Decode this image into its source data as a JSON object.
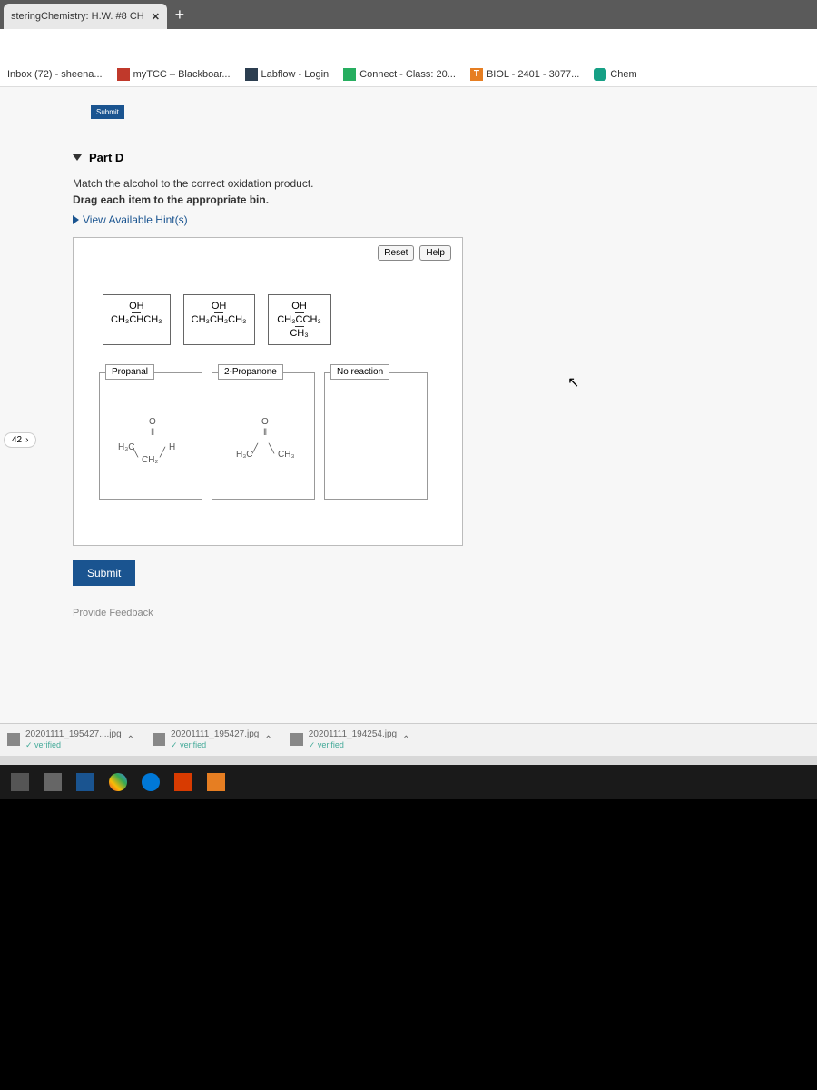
{
  "tab": {
    "title": "steringChemistry: H.W. #8 CH",
    "close": "✕",
    "newTab": "+"
  },
  "bookmarks": [
    {
      "label": "Inbox (72) - sheena..."
    },
    {
      "label": "myTCC – Blackboar..."
    },
    {
      "label": "Labflow - Login"
    },
    {
      "label": "Connect - Class: 20..."
    },
    {
      "label": "BIOL - 2401 - 3077..."
    },
    {
      "label": "Chem"
    }
  ],
  "pageNav": {
    "num": "42",
    "arrow": "›"
  },
  "badge": "Submit",
  "section": {
    "title": "Part D",
    "instr1": "Match the alcohol to the correct oxidation product.",
    "instr2": "Drag each item to the appropriate bin.",
    "hint": "View Available Hint(s)"
  },
  "buttons": {
    "reset": "Reset",
    "help": "Help"
  },
  "dragItems": [
    {
      "top": "OH",
      "bottom": "CH₃CHCH₃"
    },
    {
      "top": "OH",
      "bottom": "CH₃CH₂CH₃"
    },
    {
      "top": "OH",
      "mid": "CH₃CCH₃",
      "bottom": "CH₃"
    }
  ],
  "bins": [
    {
      "label": "Propanal",
      "structLeft": "H₃C",
      "structMid": "CH₂",
      "structRight": "H",
      "structTop": "O"
    },
    {
      "label": "2-Propanone",
      "structLeft": "H₃C",
      "structRight": "CH₃",
      "structTop": "O"
    },
    {
      "label": "No reaction"
    }
  ],
  "submit": "Submit",
  "feedback": "Provide Feedback",
  "downloads": [
    {
      "name": "20201111_195427....jpg",
      "status": "verified"
    },
    {
      "name": "20201111_195427.jpg",
      "status": "verified"
    },
    {
      "name": "20201111_194254.jpg",
      "status": "verified"
    }
  ]
}
